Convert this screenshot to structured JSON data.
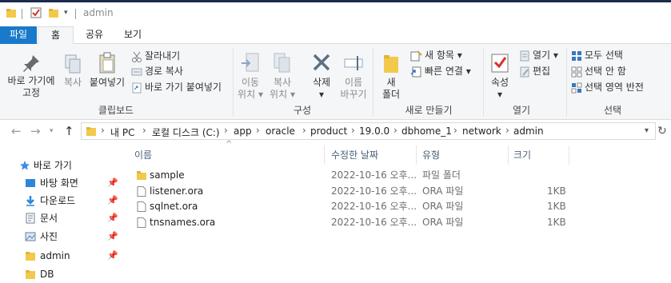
{
  "title_bar": {
    "path_title": "admin"
  },
  "tabs": {
    "file": "파일",
    "home": "홈",
    "share": "공유",
    "view": "보기"
  },
  "ribbon": {
    "clipboard": {
      "pin_label_line1": "바로 가기에",
      "pin_label_line2": "고정",
      "copy": "복사",
      "paste": "붙여넣기",
      "cut": "잘라내기",
      "copy_path": "경로 복사",
      "paste_shortcut": "바로 가기 붙여넣기",
      "group": "클립보드"
    },
    "organize": {
      "move_line1": "이동",
      "move_line2": "위치",
      "copyto_line1": "복사",
      "copyto_line2": "위치",
      "delete": "삭제",
      "rename_line1": "이름",
      "rename_line2": "바꾸기",
      "group": "구성"
    },
    "new": {
      "folder_line1": "새",
      "folder_line2": "폴더",
      "new_item": "새 항목",
      "easy_access": "빠른 연결",
      "group": "새로 만들기"
    },
    "open": {
      "properties": "속성",
      "open": "열기",
      "edit": "편집",
      "group": "열기"
    },
    "select": {
      "select_all": "모두 선택",
      "select_none": "선택 안 함",
      "invert": "선택 영역 반전",
      "group": "선택"
    }
  },
  "address": {
    "crumbs": [
      "내 PC",
      "로컬 디스크 (C:)",
      "app",
      "oracle",
      "product",
      "19.0.0",
      "dbhome_1",
      "network",
      "admin"
    ]
  },
  "nav": {
    "quick_access": "바로 가기",
    "items": [
      "바탕 화면",
      "다운로드",
      "문서",
      "사진",
      "admin",
      "DB"
    ]
  },
  "columns": {
    "name": "이름",
    "date": "수정한 날짜",
    "type": "유형",
    "size": "크기"
  },
  "files": [
    {
      "name": "sample",
      "date": "2022-10-16 오후...",
      "type": "파일 폴더",
      "size": "",
      "kind": "folder"
    },
    {
      "name": "listener.ora",
      "date": "2022-10-16 오후...",
      "type": "ORA 파일",
      "size": "1KB",
      "kind": "file"
    },
    {
      "name": "sqlnet.ora",
      "date": "2022-10-16 오후...",
      "type": "ORA 파일",
      "size": "1KB",
      "kind": "file"
    },
    {
      "name": "tnsnames.ora",
      "date": "2022-10-16 오후...",
      "type": "ORA 파일",
      "size": "1KB",
      "kind": "file"
    }
  ],
  "colors": {
    "accent": "#1979ca",
    "folder": "#f2c94c",
    "ribbon_bg": "#f5f6f7"
  }
}
